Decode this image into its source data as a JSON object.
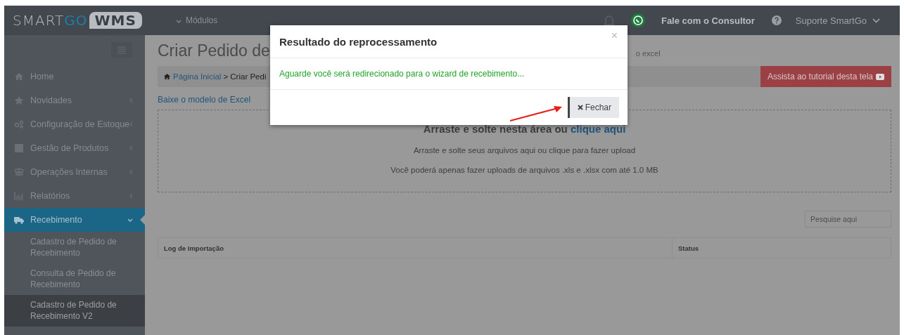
{
  "topbar": {
    "logo": [
      "SMART",
      "GO",
      "WMS"
    ],
    "modules_menu": "Módulos",
    "consultant": "Fale com o Consultor",
    "user": "Suporte SmartGo"
  },
  "sidebar": {
    "items": [
      {
        "label": "Home",
        "selected": false
      },
      {
        "label": "Novidades",
        "selected": false,
        "expanded": false
      },
      {
        "label": "Configuração de Estoque",
        "selected": false,
        "expanded": false
      },
      {
        "label": "Gestão de Produtos",
        "selected": false,
        "expanded": false
      },
      {
        "label": "Operações Internas",
        "selected": false,
        "expanded": false
      },
      {
        "label": "Relatórios",
        "selected": false,
        "expanded": false
      },
      {
        "label": "Recebimento",
        "selected": true,
        "expanded": true,
        "children": [
          {
            "label": "Cadastro de Pedido de Recebimento",
            "selected": false
          },
          {
            "label": "Consulta de Pedido de Recebimento",
            "selected": false
          },
          {
            "label": "Cadastro de Pedido de Recebimento V2",
            "selected": true
          }
        ]
      }
    ]
  },
  "page": {
    "title": "Criar Pedido de",
    "subtitle": "o excel",
    "breadcrumb": {
      "home": "Página Inicial",
      "current": "> Criar Pedi"
    },
    "tutorial_button": "Assista ao tutorial desta tela",
    "download_link": "Baixe o modelo de Excel",
    "dropzone": {
      "title": "Arraste e solte nesta área ou ",
      "title_link": "clique aqui",
      "hint": "Arraste e solte seus arquivos aqui ou clique para fazer upload",
      "limit": "Você poderá apenas fazer uploads de arquivos .xls e .xlsx com até 1.0 MB"
    },
    "search": {
      "placeholder": "Pesquise aqui"
    },
    "table": {
      "columns": [
        "Log de Importação",
        "Status"
      ]
    }
  },
  "modal": {
    "title": "Resultado do reprocessamento",
    "close": "×",
    "message": "Aguarde você será redirecionado para o wizard de recebimento...",
    "button": "Fechar"
  }
}
